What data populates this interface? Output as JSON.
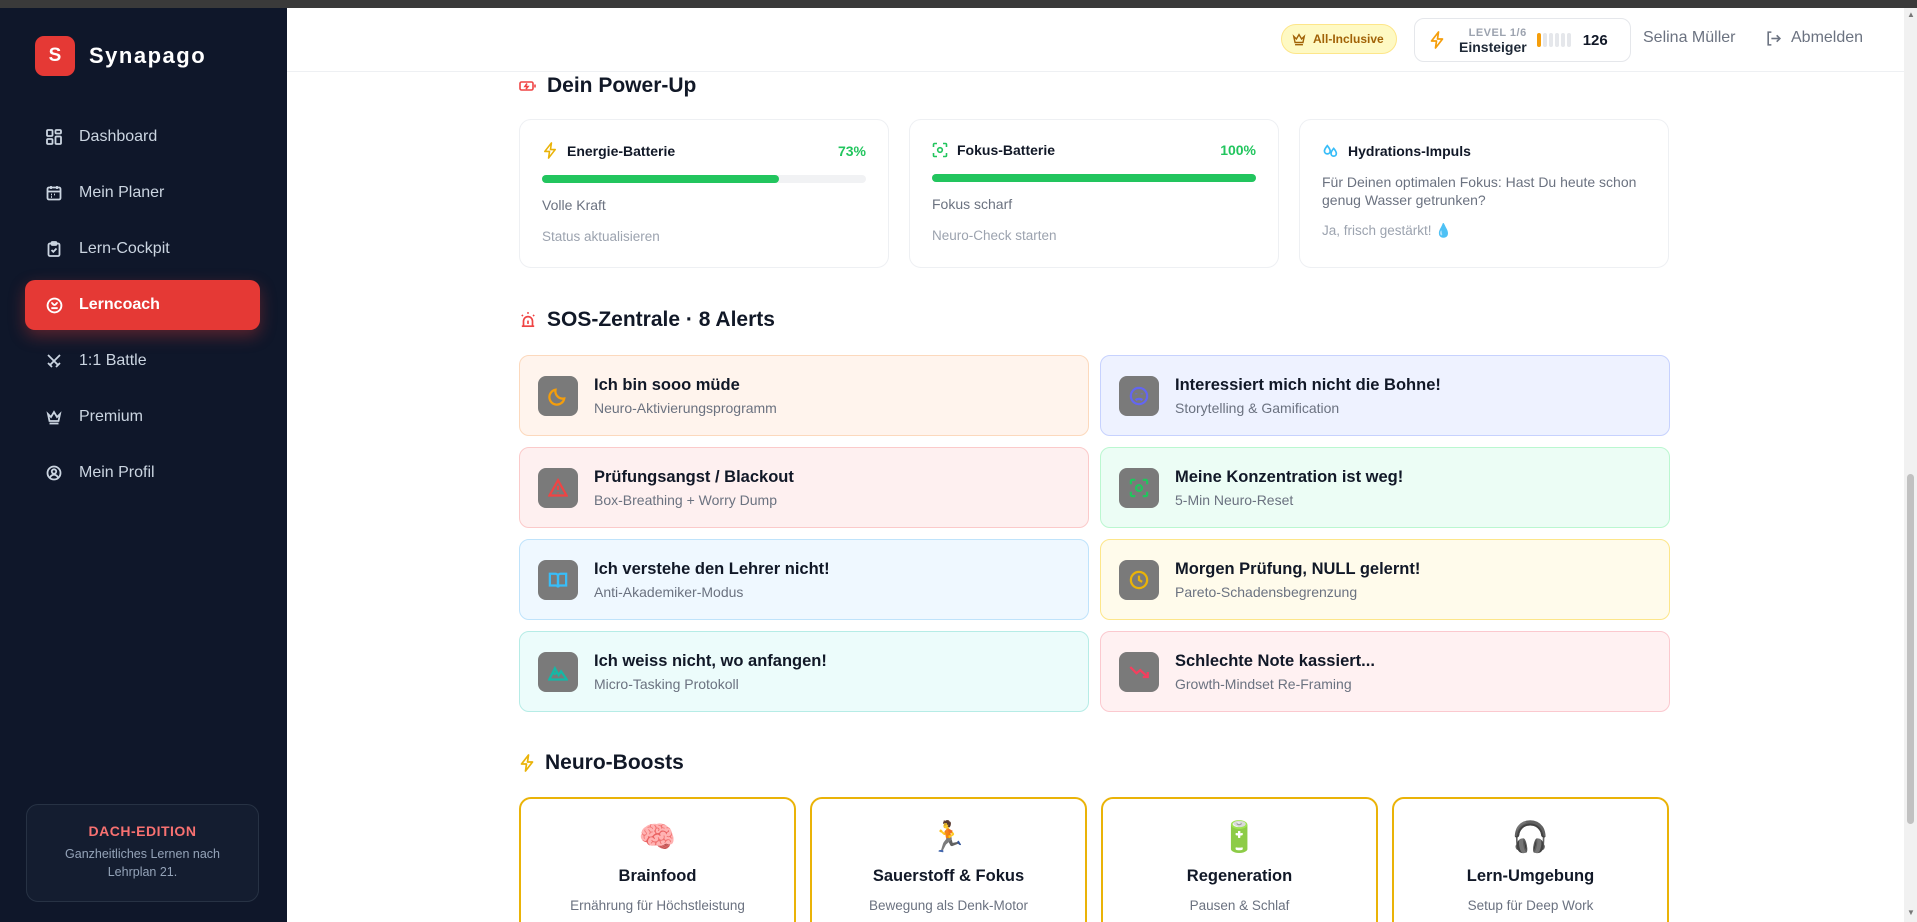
{
  "app": {
    "logo_letter": "S",
    "name": "Synapago"
  },
  "sidebar": {
    "items": [
      {
        "label": "Dashboard",
        "icon": "dashboard-icon"
      },
      {
        "label": "Mein Planer",
        "icon": "calendar-icon"
      },
      {
        "label": "Lern-Cockpit",
        "icon": "clipboard-icon"
      },
      {
        "label": "Lerncoach",
        "icon": "coach-icon",
        "active": true
      },
      {
        "label": "1:1 Battle",
        "icon": "swords-icon"
      },
      {
        "label": "Premium",
        "icon": "crown-icon"
      },
      {
        "label": "Mein Profil",
        "icon": "user-circle-icon"
      }
    ],
    "edition": {
      "title": "DACH-EDITION",
      "text": "Ganzheitliches Lernen nach Lehrplan 21."
    }
  },
  "header": {
    "plan_badge": "All-Inclusive",
    "level_label": "LEVEL 1/6",
    "level_name": "Einsteiger",
    "level_progress": 0.1667,
    "points": "126",
    "user_name": "Selina Müller",
    "logout_label": "Abmelden"
  },
  "powerup": {
    "title": "Dein Power-Up",
    "cards": [
      {
        "title": "Energie-Batterie",
        "percent": "73%",
        "value": 0.73,
        "status": "Volle Kraft",
        "link": "Status aktualisieren"
      },
      {
        "title": "Fokus-Batterie",
        "percent": "100%",
        "value": 1.0,
        "status": "Fokus scharf",
        "link": "Neuro-Check starten"
      },
      {
        "title": "Hydrations-Impuls",
        "text": "Für Deinen optimalen Fokus: Hast Du heute schon genug Wasser getrunken?",
        "link": "Ja, frisch gestärkt! 💧"
      }
    ]
  },
  "sos": {
    "title": "SOS-Zentrale · 8 Alerts",
    "alerts": [
      {
        "title": "Ich bin sooo müde",
        "sub": "Neuro-Aktivierungsprogramm",
        "icon": "moon-icon",
        "bg": "#fff4ed",
        "border": "#fcd9bd",
        "accent": "#f59e0b"
      },
      {
        "title": "Interessiert mich nicht die Bohne!",
        "sub": "Storytelling & Gamification",
        "icon": "sad-face-icon",
        "bg": "#eef2ff",
        "border": "#c7d2fe",
        "accent": "#6366f1"
      },
      {
        "title": "Prüfungsangst / Blackout",
        "sub": "Box-Breathing + Worry Dump",
        "icon": "warning-icon",
        "bg": "#fef0f0",
        "border": "#fbcaca",
        "accent": "#ef4444"
      },
      {
        "title": "Meine Konzentration ist weg!",
        "sub": "5-Min Neuro-Reset",
        "icon": "focus-icon",
        "bg": "#ecfdf5",
        "border": "#bbf7d0",
        "accent": "#22c55e"
      },
      {
        "title": "Ich verstehe den Lehrer nicht!",
        "sub": "Anti-Akademiker-Modus",
        "icon": "book-icon",
        "bg": "#eff8ff",
        "border": "#bfe3fb",
        "accent": "#38bdf8"
      },
      {
        "title": "Morgen Prüfung, NULL gelernt!",
        "sub": "Pareto-Schadensbegrenzung",
        "icon": "clock-icon",
        "bg": "#fffbeb",
        "border": "#fde68a",
        "accent": "#eab308"
      },
      {
        "title": "Ich weiss nicht, wo anfangen!",
        "sub": "Micro-Tasking Protokoll",
        "icon": "mountain-icon",
        "bg": "#ecfcfb",
        "border": "#b6ece6",
        "accent": "#14b8a6"
      },
      {
        "title": "Schlechte Note kassiert...",
        "sub": "Growth-Mindset Re-Framing",
        "icon": "trending-down-icon",
        "bg": "#fff1f2",
        "border": "#fbc9cf",
        "accent": "#f43f5e"
      }
    ]
  },
  "boosts": {
    "title": "Neuro-Boosts",
    "items": [
      {
        "emoji": "🧠",
        "title": "Brainfood",
        "sub": "Ernährung für Höchstleistung"
      },
      {
        "emoji": "🏃",
        "title": "Sauerstoff & Fokus",
        "sub": "Bewegung als Denk-Motor"
      },
      {
        "emoji": "🔋",
        "title": "Regeneration",
        "sub": "Pausen & Schlaf"
      },
      {
        "emoji": "🎧",
        "title": "Lern-Umgebung",
        "sub": "Setup für Deep Work"
      }
    ]
  }
}
